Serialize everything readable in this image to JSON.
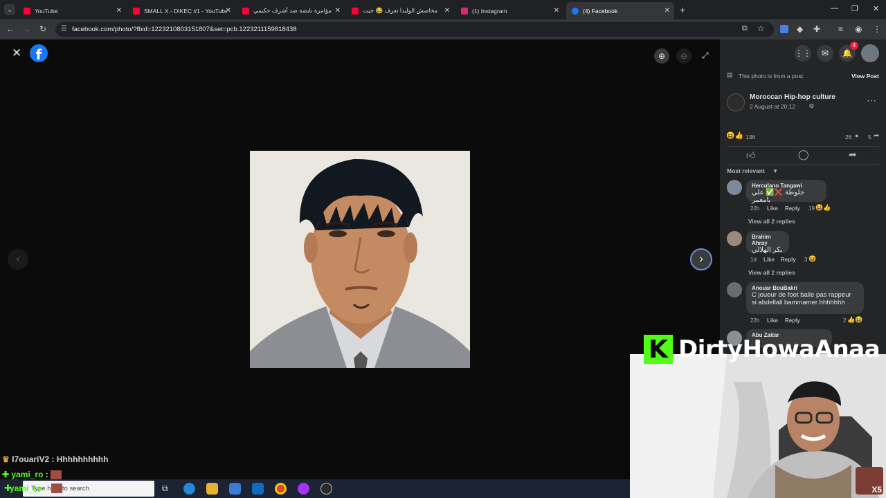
{
  "browser": {
    "tabs": [
      {
        "label": "YouTube",
        "color": "#ff0033"
      },
      {
        "label": "SMALL X - DIKEÇ #1 - YouTube",
        "color": "#ff0033"
      },
      {
        "label": "مؤامرة نايضة ضد أشرف حكيمي",
        "color": "#ff0033"
      },
      {
        "label": "مخاصش الوليدا تعرف 😂 جيت",
        "color": "#ff0033"
      },
      {
        "label": "(1) Instagram",
        "color": "#d62976"
      },
      {
        "label": "(4) Facebook",
        "color": "#1877f2"
      }
    ],
    "url": "facebook.com/photo/?fbid=1223210803151807&set=pcb.1223211159818438"
  },
  "panel": {
    "notice": "This photo is from a post.",
    "view_post": "View Post",
    "notif_count": "4",
    "page_name": "Moroccan Hip-hop culture",
    "post_time": "2 August at 20:12 ·",
    "reactions_count": "136",
    "comments_count": "26",
    "shares_count": "5",
    "sort_label": "Most relevant",
    "comments": [
      {
        "author": "Herculano Tangawi",
        "text": "جلوطة ❌✅ علي بامعمر",
        "time": "22h",
        "like": "Like",
        "reply": "Reply",
        "reacts": "19",
        "view_replies": "View all 2 replies"
      },
      {
        "author": "Brahim Ahray",
        "text": "بكر الهلالي",
        "time": "1d",
        "like": "Like",
        "reply": "Reply",
        "reacts": "3",
        "view_replies": "View all 2 replies"
      },
      {
        "author": "Anouar BouBakri",
        "text_line1": "C joueur de foot balle pas rappeur",
        "text_line2": "si abdellali bammamer hhhhhhh",
        "time": "22h",
        "like": "Like",
        "reply": "Reply",
        "reacts": "2"
      },
      {
        "author": "Abu Zaitar"
      }
    ]
  },
  "stream": {
    "brand": "DirtyHowaAnaa",
    "brand_letter": "K",
    "corner_badge": "X5",
    "chat": [
      {
        "user": "I7ouariV2",
        "message": " : Hhhhhhhhhh"
      },
      {
        "user": "yami_ro",
        "message": " :"
      },
      {
        "user": "yami_ro",
        "message": ""
      }
    ]
  },
  "taskbar": {
    "search_placeholder": "Type here to search"
  }
}
